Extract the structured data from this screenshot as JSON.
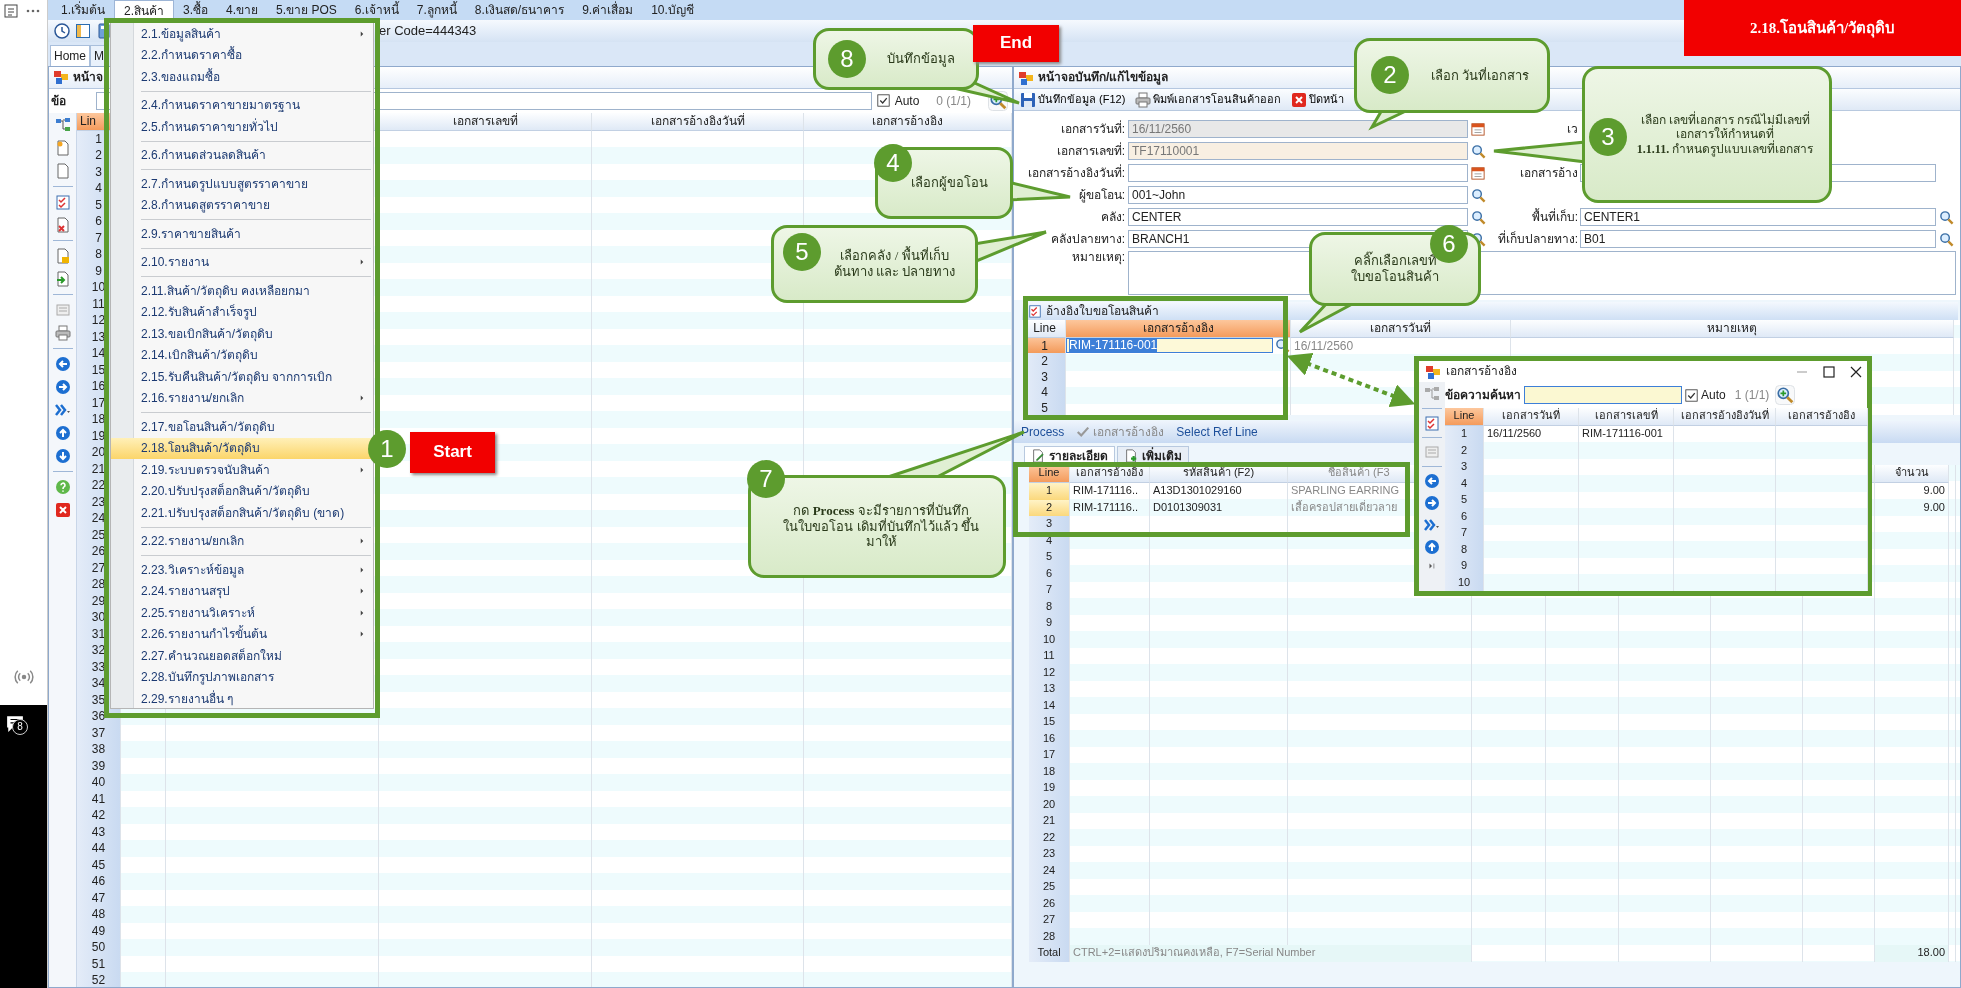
{
  "left_strip": {
    "badge": "8"
  },
  "menu_bar": [
    {
      "label": "1.เริ่มต้น",
      "selected": false
    },
    {
      "label": "2.สินค้า",
      "selected": true
    },
    {
      "label": "3.ซื้อ",
      "selected": false
    },
    {
      "label": "4.ขาย",
      "selected": false
    },
    {
      "label": "5.ขาย POS",
      "selected": false
    },
    {
      "label": "6.เจ้าหนี้",
      "selected": false
    },
    {
      "label": "7.ลูกหนี้",
      "selected": false
    },
    {
      "label": "8.เงินสด/ธนาคาร",
      "selected": false
    },
    {
      "label": "9.ค่าเสื่อม",
      "selected": false
    },
    {
      "label": "10.บัญชี",
      "selected": false
    }
  ],
  "toolbar_text": "er Code=444343",
  "home_tabs": [
    {
      "label": "Home",
      "selected": true
    },
    {
      "label": "M",
      "selected": false
    }
  ],
  "title_banner": "2.18.โอนสินค้า/วัตถุดิบ",
  "list_window": {
    "title": "หน้าจ",
    "search_label": "ข้อ",
    "auto": {
      "label": "Auto",
      "checked": true
    },
    "count": "0 (1/1)",
    "columns": [
      "Lin",
      "เอกสารเลขที่",
      "เอกสารอ้างอิงวันที่",
      "เอกสารอ้างอิง"
    ],
    "line_numbers": [
      "1",
      "2",
      "3",
      "4",
      "5",
      "6",
      "7",
      "8",
      "9",
      "10",
      "11",
      "12",
      "13",
      "14",
      "15",
      "16",
      "17",
      "18",
      "19",
      "20",
      "21",
      "22",
      "23",
      "24",
      "25",
      "26",
      "27",
      "28",
      "29",
      "30",
      "31",
      "32",
      "33",
      "34",
      "35",
      "36",
      "37",
      "38",
      "39",
      "40",
      "41",
      "42",
      "43",
      "44",
      "45",
      "46",
      "47",
      "48",
      "49",
      "50",
      "51",
      "52"
    ]
  },
  "dropdown_menu": {
    "groups": [
      [
        {
          "label": "2.1.ข้อมูลสินค้า",
          "submenu": true,
          "selected": false
        },
        {
          "label": "2.2.กำหนดราคาซื้อ",
          "submenu": false,
          "selected": false
        },
        {
          "label": "2.3.ของแถมซื้อ",
          "submenu": false,
          "selected": false
        }
      ],
      [
        {
          "label": "2.4.กำหนดราคาขายมาตรฐาน",
          "submenu": false,
          "selected": false
        },
        {
          "label": "2.5.กำหนดราคาขายทั่วไป",
          "submenu": false,
          "selected": false
        }
      ],
      [
        {
          "label": "2.6.กำหนดส่วนลดสินค้า",
          "submenu": false,
          "selected": false
        }
      ],
      [
        {
          "label": "2.7.กำหนดรูปแบบสูตรราคาขาย",
          "submenu": false,
          "selected": false
        },
        {
          "label": "2.8.กำหนดสูตรราคาขาย",
          "submenu": false,
          "selected": false
        }
      ],
      [
        {
          "label": "2.9.ราคาขายสินค้า",
          "submenu": false,
          "selected": false
        }
      ],
      [
        {
          "label": "2.10.รายงาน",
          "submenu": true,
          "selected": false
        }
      ],
      [
        {
          "label": "2.11.สินค้า/วัตถุดิบ คงเหลือยกมา",
          "submenu": false,
          "selected": false
        },
        {
          "label": "2.12.รับสินค้าสำเร็จรูป",
          "submenu": false,
          "selected": false
        },
        {
          "label": "2.13.ขอเบิกสินค้า/วัตถุดิบ",
          "submenu": false,
          "selected": false
        },
        {
          "label": "2.14.เบิกสินค้า/วัตถุดิบ",
          "submenu": false,
          "selected": false
        },
        {
          "label": "2.15.รับคืนสินค้า/วัตถุดิบ จากการเบิก",
          "submenu": false,
          "selected": false
        },
        {
          "label": "2.16.รายงาน/ยกเลิก",
          "submenu": true,
          "selected": false
        }
      ],
      [
        {
          "label": "2.17.ขอโอนสินค้า/วัตถุดิบ",
          "submenu": false,
          "selected": false
        },
        {
          "label": "2.18.โอนสินค้า/วัตถุดิบ",
          "submenu": false,
          "selected": true
        },
        {
          "label": "2.19.ระบบตรวจนับสินค้า",
          "submenu": true,
          "selected": false
        },
        {
          "label": "2.20.ปรับปรุงสต็อกสินค้า/วัตถุดิบ",
          "submenu": false,
          "selected": false
        },
        {
          "label": "2.21.ปรับปรุงสต็อกสินค้า/วัตถุดิบ (ขาด)",
          "submenu": false,
          "selected": false
        }
      ],
      [
        {
          "label": "2.22.รายงาน/ยกเลิก",
          "submenu": true,
          "selected": false
        }
      ],
      [
        {
          "label": "2.23.วิเคราะห์ข้อมูล",
          "submenu": true,
          "selected": false
        },
        {
          "label": "2.24.รายงานสรุป",
          "submenu": true,
          "selected": false
        },
        {
          "label": "2.25.รายงานวิเคราะห์",
          "submenu": true,
          "selected": false
        },
        {
          "label": "2.26.รายงานกำไรขั้นต้น",
          "submenu": true,
          "selected": false
        },
        {
          "label": "2.27.คำนวณยอดสต็อกใหม่",
          "submenu": false,
          "selected": false
        },
        {
          "label": "2.28.บันทึกรูปภาพเอกสาร",
          "submenu": false,
          "selected": false
        },
        {
          "label": "2.29.รายงานอื่น ๆ",
          "submenu": false,
          "selected": false
        }
      ]
    ]
  },
  "form_window": {
    "title": "หน้าจอบันทึก/แก้ไขข้อมูล",
    "toolbar": [
      {
        "label": "บันทึกข้อมูล (F12)"
      },
      {
        "label": "พิมพ์เอกสารโอนสินค้าออก"
      },
      {
        "label": "ปิดหน้า"
      }
    ],
    "fields": [
      {
        "label": "เอกสารวันที่:",
        "value": "16/11/2560",
        "kind": "date",
        "disabled": true,
        "side": {
          "label": "เว",
          "kind": "label"
        }
      },
      {
        "label": "เอกสารเลขที่:",
        "value": "TF17110001",
        "kind": "lookup",
        "disabled": true
      },
      {
        "label": "เอกสารอ้างอิงวันที่:",
        "kind": "date",
        "disabled": false,
        "side": {
          "label": "เอกสารอ้าง",
          "kind": "text"
        }
      },
      {
        "label": "ผู้ขอโอน:",
        "value": "001~John",
        "kind": "lookup",
        "disabled": false
      },
      {
        "label": "คลัง:",
        "value": "CENTER",
        "kind": "lookup",
        "disabled": false,
        "side": {
          "label": "พื้นที่เก็บ:",
          "value": "CENTER1",
          "kind": "lookup"
        }
      },
      {
        "label": "คลังปลายทาง:",
        "value": "BRANCH1",
        "kind": "lookup",
        "disabled": false,
        "side": {
          "label": "ที่เก็บปลายทาง:",
          "value": "B01",
          "kind": "lookup"
        }
      },
      {
        "label": "หมายเหตุ:",
        "kind": "memo",
        "disabled": false
      }
    ]
  },
  "reference": {
    "title": "อ้างอิงใบขอโอนสินค้า",
    "columns": [
      "Line",
      "เอกสารอ้างอิง",
      "เอกสารวันที่",
      "หมายเหตุ"
    ],
    "rows": [
      {
        "line": "1",
        "selected": true,
        "ref": "RIM-171116-001",
        "date": "16/11/2560"
      },
      {
        "line": "2",
        "selected": false
      },
      {
        "line": "3",
        "selected": false
      },
      {
        "line": "4",
        "selected": false
      },
      {
        "line": "5",
        "selected": false
      }
    ]
  },
  "process_bar": [
    {
      "label": "Process",
      "disabled": false
    },
    {
      "label": "เอกสารอ้างอิง",
      "disabled": true
    },
    {
      "label": "Select Ref Line",
      "disabled": false
    }
  ],
  "detail_tabs": [
    {
      "label": "รายละเอียด",
      "selected": true
    },
    {
      "label": "เพิ่มเติม",
      "selected": false
    }
  ],
  "detail_grid": {
    "columns": [
      "Line",
      "เอกสารอ้างอิง",
      "รหัสสินค้า (F2)",
      "ชื่อสินค้า (F3",
      "จำนวน"
    ],
    "rows": [
      {
        "ref": "RIM-171116..",
        "code": "A13D1301029160",
        "name": "SPARLING EARRING",
        "qty": "9.00"
      },
      {
        "ref": "RIM-171116..",
        "code": "D0101309031",
        "name": "เสื้อครอปสายเดี่ยวลาย",
        "qty": "9.00"
      }
    ],
    "line_numbers": [
      "1",
      "2",
      "3",
      "4",
      "5",
      "6",
      "7",
      "8",
      "9",
      "10",
      "11",
      "12",
      "13",
      "14",
      "15",
      "16",
      "17",
      "18",
      "19",
      "20",
      "21",
      "22",
      "23",
      "24",
      "25",
      "26",
      "27",
      "28"
    ],
    "total_label": "Total",
    "total_hint": "CTRL+2=แสดงปริมาณคงเหลือ, F7=Serial Number",
    "total_qty": "18.00"
  },
  "popup": {
    "title": "เอกสารอ้างอิง",
    "search_label": "ข้อความค้นหา",
    "auto": {
      "label": "Auto",
      "checked": true
    },
    "count": "1 (1/1)",
    "columns": [
      "Line",
      "เอกสารวันที่",
      "เอกสารเลขที่",
      "เอกสารอ้างอิงวันที่",
      "เอกสารอ้างอิง"
    ],
    "rows": [
      {
        "date": "16/11/2560",
        "number": "RIM-171116-001"
      }
    ],
    "line_numbers": [
      "1",
      "2",
      "3",
      "4",
      "5",
      "6",
      "7",
      "8",
      "9",
      "10"
    ]
  },
  "tags": [
    {
      "step": "1",
      "text": "Start"
    },
    {
      "text": "End"
    }
  ],
  "callouts": [
    {
      "step": "8",
      "lines": [
        "บันทึกข้อมูล"
      ]
    },
    {
      "step": "2",
      "lines": [
        "เลือก วันที่เอกสาร"
      ]
    },
    {
      "step": "3",
      "lines": [
        "เลือก เลขที่เอกสาร กรณีไม่มีเลขที่",
        "เอกสารให้กำหนดที่",
        "**1.1.11.** กำหนดรูปแบบเลขที่เอกสาร"
      ]
    },
    {
      "step": "4",
      "lines": [
        "เลือกผู้ขอโอน"
      ]
    },
    {
      "step": "5",
      "lines": [
        "เลือกคลัง / พื้นที่เก็บ",
        "ต้นทาง และ ปลายทาง"
      ]
    },
    {
      "step": "6",
      "lines": [
        "คลิ๊กเลือกเลขที่",
        "ใบขอโอนสินค้า"
      ]
    },
    {
      "step": "7",
      "lines": [
        "กด **Process** จะมีรายการที่บันทึก",
        "ในใบขอโอน เดิมที่บันทึกไว้แล้ว ขึ้น",
        "มาให้"
      ]
    }
  ]
}
